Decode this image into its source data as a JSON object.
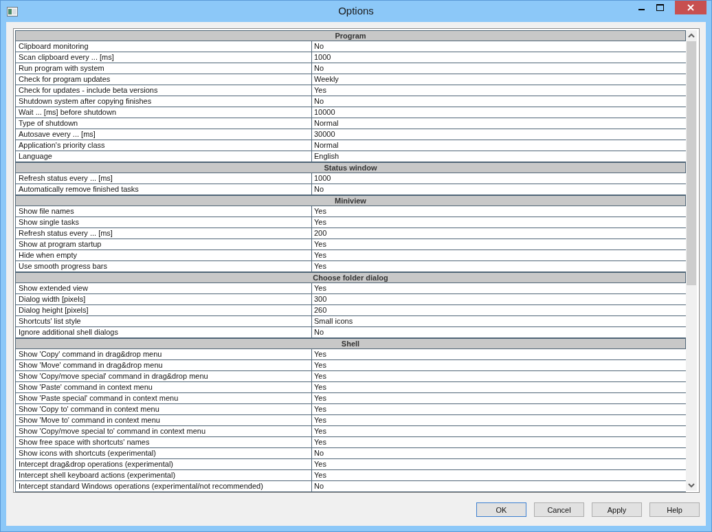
{
  "window": {
    "title": "Options"
  },
  "sections": [
    {
      "title": "Program",
      "rows": [
        {
          "name": "Clipboard monitoring",
          "value": "No"
        },
        {
          "name": "Scan clipboard every ... [ms]",
          "value": "1000"
        },
        {
          "name": "Run program with system",
          "value": "No"
        },
        {
          "name": "Check for program updates",
          "value": "Weekly"
        },
        {
          "name": "Check for updates - include beta versions",
          "value": "Yes"
        },
        {
          "name": "Shutdown system after copying finishes",
          "value": "No"
        },
        {
          "name": "Wait ... [ms] before shutdown",
          "value": "10000"
        },
        {
          "name": "Type of shutdown",
          "value": "Normal"
        },
        {
          "name": "Autosave every ... [ms]",
          "value": "30000"
        },
        {
          "name": "Application's priority class",
          "value": "Normal"
        },
        {
          "name": "Language",
          "value": "English"
        }
      ]
    },
    {
      "title": "Status window",
      "rows": [
        {
          "name": "Refresh status every ... [ms]",
          "value": "1000"
        },
        {
          "name": "Automatically remove finished tasks",
          "value": "No"
        }
      ]
    },
    {
      "title": "Miniview",
      "rows": [
        {
          "name": "Show file names",
          "value": "Yes"
        },
        {
          "name": "Show single tasks",
          "value": "Yes"
        },
        {
          "name": "Refresh status every ... [ms]",
          "value": "200"
        },
        {
          "name": "Show at program startup",
          "value": "Yes"
        },
        {
          "name": "Hide when empty",
          "value": "Yes"
        },
        {
          "name": "Use smooth progress bars",
          "value": "Yes"
        }
      ]
    },
    {
      "title": "Choose folder dialog",
      "rows": [
        {
          "name": "Show extended view",
          "value": "Yes"
        },
        {
          "name": "Dialog width [pixels]",
          "value": "300"
        },
        {
          "name": "Dialog height [pixels]",
          "value": "260"
        },
        {
          "name": "Shortcuts' list style",
          "value": "Small icons"
        },
        {
          "name": "Ignore additional shell dialogs",
          "value": "No"
        }
      ]
    },
    {
      "title": "Shell",
      "rows": [
        {
          "name": "Show 'Copy' command in drag&drop menu",
          "value": "Yes"
        },
        {
          "name": "Show 'Move' command in drag&drop menu",
          "value": "Yes"
        },
        {
          "name": "Show 'Copy/move special' command in drag&drop menu",
          "value": "Yes"
        },
        {
          "name": "Show 'Paste' command in context menu",
          "value": "Yes"
        },
        {
          "name": "Show 'Paste special' command in context menu",
          "value": "Yes"
        },
        {
          "name": "Show 'Copy to' command in context menu",
          "value": "Yes"
        },
        {
          "name": "Show 'Move to' command in context menu",
          "value": "Yes"
        },
        {
          "name": "Show 'Copy/move special to' command in context menu",
          "value": "Yes"
        },
        {
          "name": "Show free space with shortcuts' names",
          "value": "Yes"
        },
        {
          "name": "Show icons with shortcuts (experimental)",
          "value": "No"
        },
        {
          "name": "Intercept drag&drop operations (experimental)",
          "value": "Yes"
        },
        {
          "name": "Intercept shell keyboard actions (experimental)",
          "value": "Yes"
        },
        {
          "name": "Intercept standard Windows operations (experimental/not recommended)",
          "value": "No"
        }
      ]
    }
  ],
  "buttons": [
    {
      "label": "OK",
      "default": true
    },
    {
      "label": "Cancel",
      "default": false
    },
    {
      "label": "Apply",
      "default": false
    },
    {
      "label": "Help",
      "default": false
    }
  ]
}
